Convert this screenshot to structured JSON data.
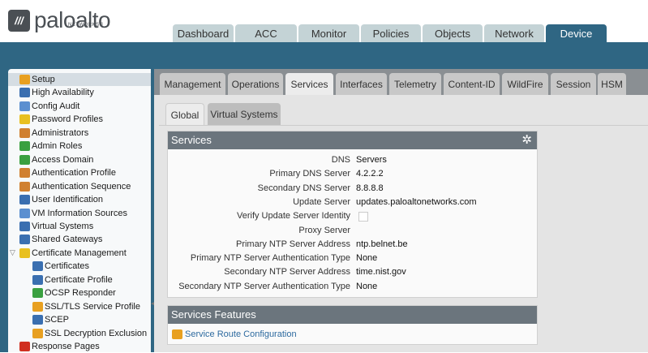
{
  "logo": {
    "brand": "paloalto",
    "sub": "NETWORKS®"
  },
  "top_tabs": [
    "Dashboard",
    "ACC",
    "Monitor",
    "Policies",
    "Objects",
    "Network",
    "Device"
  ],
  "active_top_tab": "Device",
  "sidebar": {
    "items": [
      {
        "label": "Setup",
        "indent": 0,
        "color": "#e8a020"
      },
      {
        "label": "High Availability",
        "indent": 0,
        "color": "#3a6fb0"
      },
      {
        "label": "Config Audit",
        "indent": 0,
        "color": "#5b8fd0"
      },
      {
        "label": "Password Profiles",
        "indent": 0,
        "color": "#e8c020"
      },
      {
        "label": "Administrators",
        "indent": 0,
        "color": "#d08030"
      },
      {
        "label": "Admin Roles",
        "indent": 0,
        "color": "#3aa040"
      },
      {
        "label": "Access Domain",
        "indent": 0,
        "color": "#3aa040"
      },
      {
        "label": "Authentication Profile",
        "indent": 0,
        "color": "#d08030"
      },
      {
        "label": "Authentication Sequence",
        "indent": 0,
        "color": "#d08030"
      },
      {
        "label": "User Identification",
        "indent": 0,
        "color": "#3a6fb0"
      },
      {
        "label": "VM Information Sources",
        "indent": 0,
        "color": "#5b8fd0"
      },
      {
        "label": "Virtual Systems",
        "indent": 0,
        "color": "#3a6fb0"
      },
      {
        "label": "Shared Gateways",
        "indent": 0,
        "color": "#3a6fb0"
      },
      {
        "label": "Certificate Management",
        "indent": 0,
        "color": "#e8c020"
      },
      {
        "label": "Certificates",
        "indent": 1,
        "color": "#3a6fb0"
      },
      {
        "label": "Certificate Profile",
        "indent": 1,
        "color": "#3a6fb0"
      },
      {
        "label": "OCSP Responder",
        "indent": 1,
        "color": "#3aa040"
      },
      {
        "label": "SSL/TLS Service Profile",
        "indent": 1,
        "color": "#e8a020"
      },
      {
        "label": "SCEP",
        "indent": 1,
        "color": "#3a6fb0"
      },
      {
        "label": "SSL Decryption Exclusion",
        "indent": 1,
        "color": "#e8a020"
      },
      {
        "label": "Response Pages",
        "indent": 0,
        "color": "#d03020"
      }
    ]
  },
  "sub_tabs": [
    "Management",
    "Operations",
    "Services",
    "Interfaces",
    "Telemetry",
    "Content-ID",
    "WildFire",
    "Session",
    "HSM"
  ],
  "active_sub_tab": "Services",
  "scope_tabs": [
    "Global",
    "Virtual Systems"
  ],
  "services": {
    "title": "Services",
    "rows": [
      {
        "label": "DNS",
        "value": "Servers"
      },
      {
        "label": "Primary DNS Server",
        "value": "4.2.2.2"
      },
      {
        "label": "Secondary DNS Server",
        "value": "8.8.8.8"
      },
      {
        "label": "Update Server",
        "value": "updates.paloaltonetworks.com"
      },
      {
        "label": "Verify Update Server Identity",
        "value": "",
        "checkbox": true,
        "checked": false
      },
      {
        "label": "Proxy Server",
        "value": ""
      },
      {
        "label": "Primary NTP Server Address",
        "value": "ntp.belnet.be"
      },
      {
        "label": "Primary NTP Server Authentication Type",
        "value": "None"
      },
      {
        "label": "Secondary NTP Server Address",
        "value": "time.nist.gov"
      },
      {
        "label": "Secondary NTP Server Authentication Type",
        "value": "None"
      }
    ]
  },
  "features": {
    "title": "Services Features",
    "link": "Service Route Configuration"
  }
}
